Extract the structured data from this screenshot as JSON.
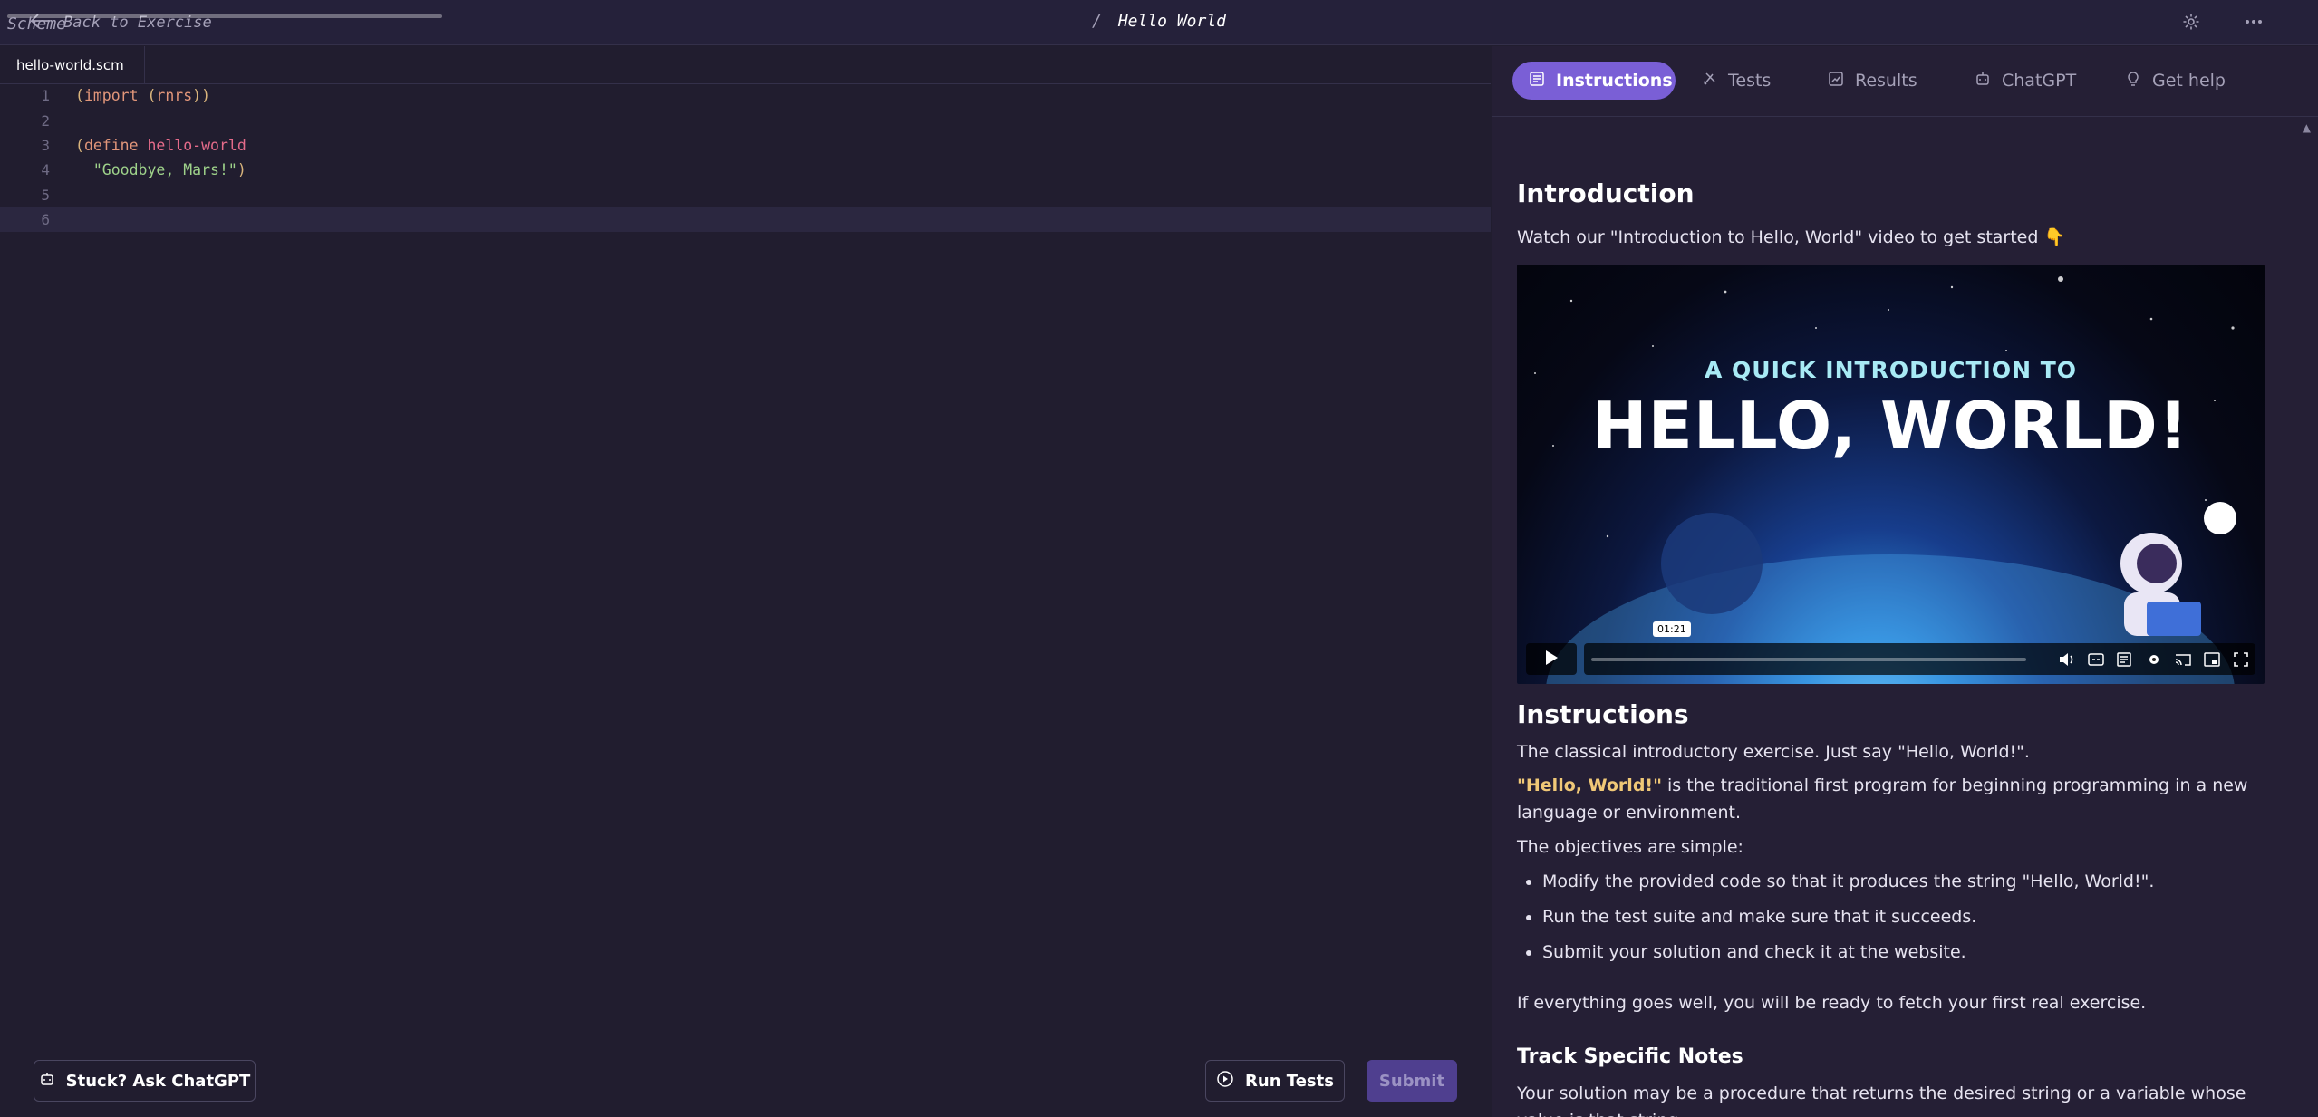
{
  "topbar": {
    "back_label": "Back to Exercise",
    "track": "Scheme",
    "separator": "/",
    "exercise": "Hello World"
  },
  "editor": {
    "filename": "hello-world.scm",
    "line_numbers": [
      "1",
      "2",
      "3",
      "4",
      "5",
      "6"
    ],
    "lines": {
      "l1": {
        "p1": "(",
        "kw": "import",
        "sp": " ",
        "p2": "(",
        "id": "rnrs",
        "p3": "))"
      },
      "l3": {
        "p1": "(",
        "kw": "define",
        "sp": " ",
        "id": "hello-world"
      },
      "l4": {
        "indent": "  ",
        "str": "\"Goodbye, Mars!\"",
        "p1": ")"
      }
    }
  },
  "buttons": {
    "ask_chatgpt": "Stuck? Ask ChatGPT",
    "run_tests": "Run Tests",
    "submit": "Submit"
  },
  "tabs": [
    {
      "label": "Instructions",
      "icon": "instructions-icon"
    },
    {
      "label": "Tests",
      "icon": "tests-icon"
    },
    {
      "label": "Results",
      "icon": "results-icon"
    },
    {
      "label": "ChatGPT",
      "icon": "chatgpt-icon"
    },
    {
      "label": "Get help",
      "icon": "lightbulb-icon"
    }
  ],
  "content": {
    "intro_heading": "Introduction",
    "intro_text": "Watch our \"Introduction to Hello, World\" video to get started 👇",
    "video": {
      "subtitle": "A QUICK INTRODUCTION TO",
      "title": "HELLO, WORLD!",
      "time": "01:21"
    },
    "instructions_heading": "Instructions",
    "instr_p1": "The classical introductory exercise. Just say \"Hello, World!\".",
    "instr_p2_highlight": "\"Hello, World!\"",
    "instr_p2_rest": " is the traditional first program for beginning programming in a new language or environment.",
    "instr_p3": "The objectives are simple:",
    "objectives": [
      "Modify the provided code so that it produces the string \"Hello, World!\".",
      "Run the test suite and make sure that it succeeds.",
      "Submit your solution and check it at the website."
    ],
    "instr_p4": "If everything goes well, you will be ready to fetch your first real exercise.",
    "notes_heading": "Track Specific Notes",
    "notes_text": "Your solution may be a procedure that returns the desired string or a variable whose value is that string."
  },
  "colors": {
    "background": "#211d2f",
    "accent": "#7a5fd6",
    "highlight": "#f0c877"
  }
}
